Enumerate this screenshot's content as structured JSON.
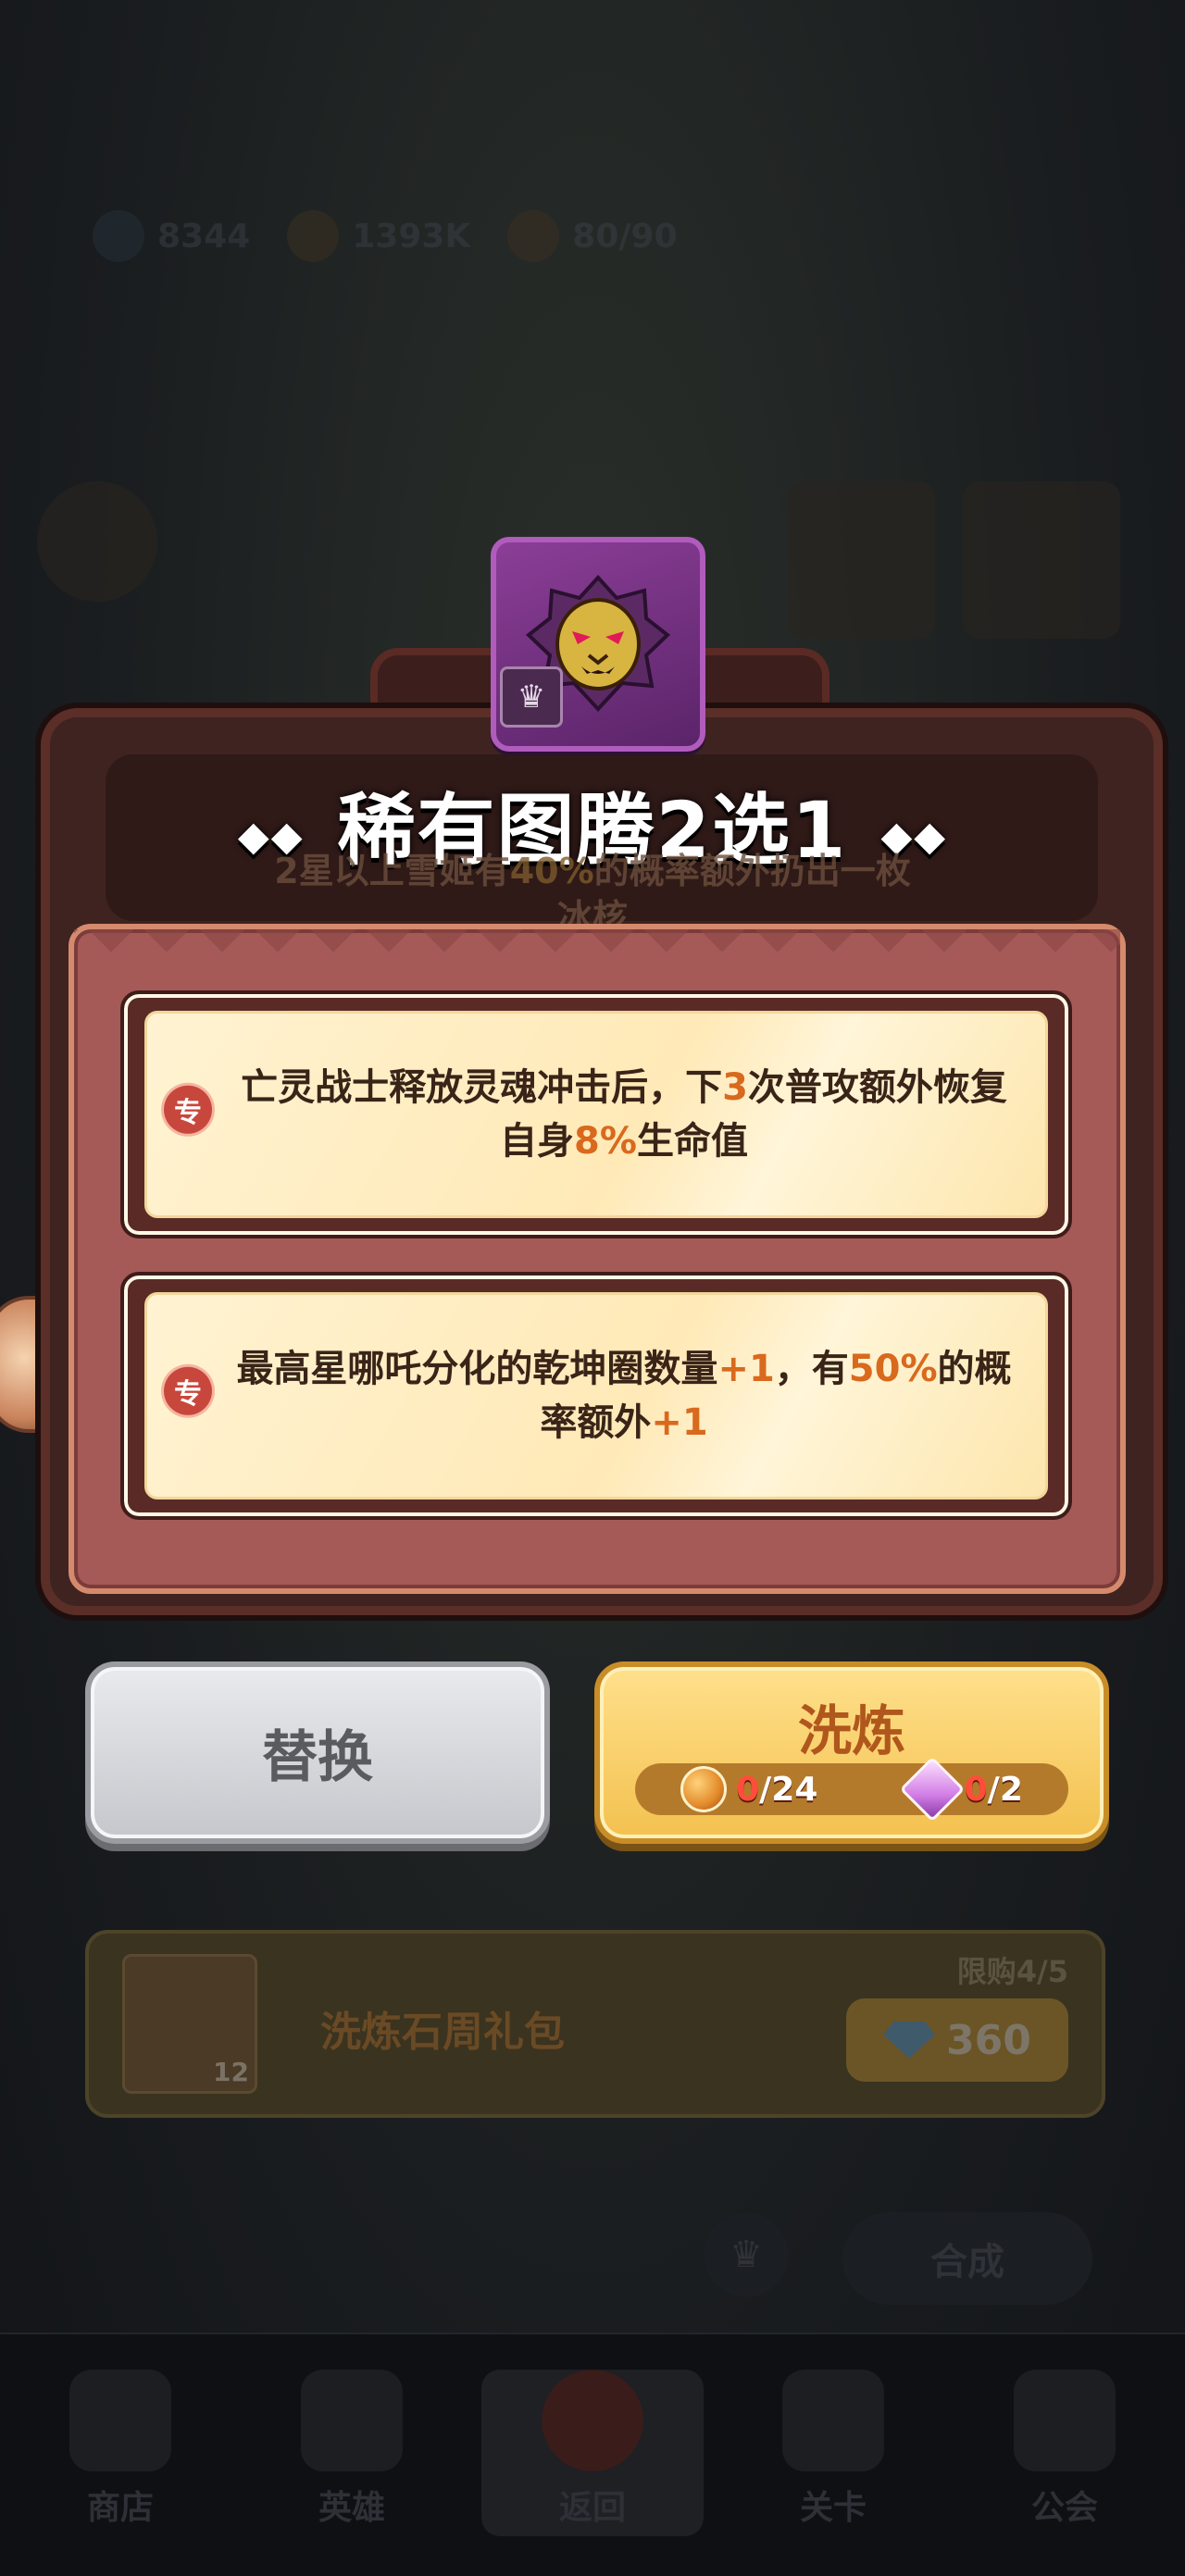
{
  "hud": {
    "gems": "8344",
    "gold": "1393K",
    "energy": "80/90"
  },
  "modal": {
    "title": "稀有图腾2选1",
    "subtitle_part1": "2星以上雪姬有",
    "subtitle_highlight": "40%",
    "subtitle_part2": "的概率额外扔出一枚",
    "subtitle_line2": "冰核",
    "crown_icon": "crown-icon",
    "totem_icon": "lion-totem-icon"
  },
  "options": [
    {
      "tag": "专",
      "segments": [
        "亡灵战士释放灵魂冲击后，下",
        "3",
        "次普攻额外恢复自身",
        "8%",
        "生命值"
      ]
    },
    {
      "tag": "专",
      "segments": [
        "最高星哪吒分化的乾坤圈数量",
        "+1",
        "，有",
        "50%",
        "的概率额外",
        "+1"
      ]
    }
  ],
  "buttons": {
    "replace": "替换",
    "refine": "洗炼",
    "refine_cost_stone_have": "0",
    "refine_cost_stone_need": "/24",
    "refine_cost_crystal_have": "0",
    "refine_cost_crystal_need": "/2"
  },
  "shop": {
    "item_name": "洗炼石周礼包",
    "item_count": "12",
    "limit": "限购4/5",
    "price": "360"
  },
  "bottom": {
    "compose_button": "合成",
    "tabs": [
      "商店",
      "英雄",
      "返回",
      "关卡",
      "公会"
    ]
  },
  "colors": {
    "highlight": "#d9691d",
    "panel": "#a55a58",
    "refine_button": "#f3c14f",
    "replace_button": "#c5c7cc"
  }
}
